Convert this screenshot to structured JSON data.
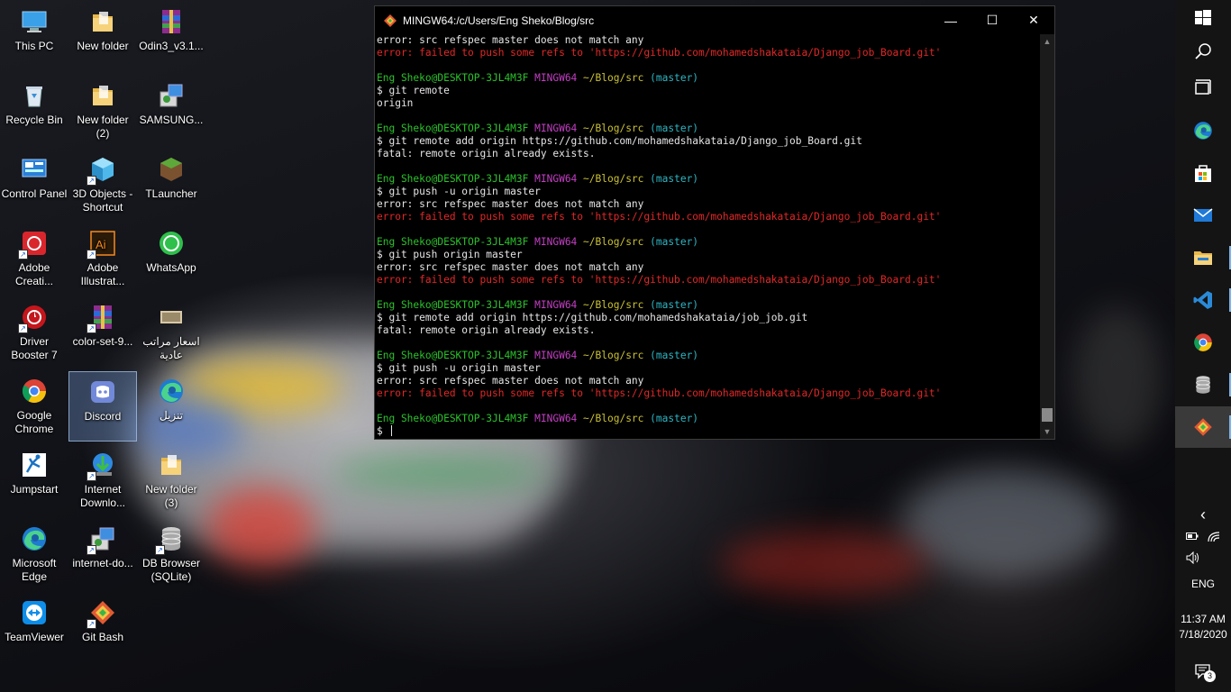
{
  "desktop": {
    "icons": [
      {
        "label": "This PC",
        "icon": "this-pc-icon"
      },
      {
        "label": "New folder",
        "icon": "folder-icon"
      },
      {
        "label": "Odin3_v3.1...",
        "icon": "winrar-icon"
      },
      {
        "label": "Recycle Bin",
        "icon": "recycle-bin-icon"
      },
      {
        "label": "New folder (2)",
        "icon": "folder-icon"
      },
      {
        "label": "SAMSUNG...",
        "icon": "installer-icon"
      },
      {
        "label": "Control Panel",
        "icon": "control-panel-icon"
      },
      {
        "label": "3D Objects - Shortcut",
        "icon": "3d-objects-icon"
      },
      {
        "label": "TLauncher",
        "icon": "minecraft-block-icon"
      },
      {
        "label": "Adobe Creati...",
        "icon": "adobe-cc-icon"
      },
      {
        "label": "Adobe Illustrat...",
        "icon": "illustrator-icon"
      },
      {
        "label": "WhatsApp",
        "icon": "whatsapp-icon"
      },
      {
        "label": "Driver Booster 7",
        "icon": "driver-booster-icon"
      },
      {
        "label": "color-set-9...",
        "icon": "winrar-icon"
      },
      {
        "label": "اسعار مراتب عادية",
        "icon": "image-file-icon"
      },
      {
        "label": "Google Chrome",
        "icon": "chrome-icon"
      },
      {
        "label": "Discord",
        "icon": "discord-icon"
      },
      {
        "label": "تنزيل",
        "icon": "edge-icon"
      },
      {
        "label": "Jumpstart",
        "icon": "jumpstart-icon"
      },
      {
        "label": "Internet Downlo...",
        "icon": "idm-icon"
      },
      {
        "label": "New folder (3)",
        "icon": "folder-icon"
      },
      {
        "label": "Microsoft Edge",
        "icon": "edge-icon"
      },
      {
        "label": "internet-do...",
        "icon": "installer-icon"
      },
      {
        "label": "DB Browser (SQLite)",
        "icon": "database-icon"
      },
      {
        "label": "TeamViewer",
        "icon": "teamviewer-icon"
      },
      {
        "label": "Git Bash",
        "icon": "git-icon"
      }
    ]
  },
  "terminal": {
    "title": "MINGW64:/c/Users/Eng Sheko/Blog/src",
    "buttons": {
      "minimize": "—",
      "maximize": "☐",
      "close": "✕"
    },
    "prompt": {
      "user": "Eng Sheko@DESKTOP-3JL4M3F",
      "env": "MINGW64",
      "path": "~/Blog/src",
      "branch": "(master)"
    },
    "lines": [
      {
        "type": "plain",
        "text": "error: src refspec master does not match any"
      },
      {
        "type": "error",
        "text": "error: failed to push some refs to 'https://github.com/mohamedshakataia/Django_job_Board.git'"
      },
      {
        "type": "blank",
        "text": ""
      },
      {
        "type": "prompt",
        "text": ""
      },
      {
        "type": "plain",
        "text": "$ git remote"
      },
      {
        "type": "plain",
        "text": "origin"
      },
      {
        "type": "blank",
        "text": ""
      },
      {
        "type": "prompt",
        "text": ""
      },
      {
        "type": "plain",
        "text": "$ git remote add origin https://github.com/mohamedshakataia/Django_job_Board.git"
      },
      {
        "type": "plain",
        "text": "fatal: remote origin already exists."
      },
      {
        "type": "blank",
        "text": ""
      },
      {
        "type": "prompt",
        "text": ""
      },
      {
        "type": "plain",
        "text": "$ git push -u origin master"
      },
      {
        "type": "plain",
        "text": "error: src refspec master does not match any"
      },
      {
        "type": "error",
        "text": "error: failed to push some refs to 'https://github.com/mohamedshakataia/Django_job_Board.git'"
      },
      {
        "type": "blank",
        "text": ""
      },
      {
        "type": "prompt",
        "text": ""
      },
      {
        "type": "plain",
        "text": "$ git push origin master"
      },
      {
        "type": "plain",
        "text": "error: src refspec master does not match any"
      },
      {
        "type": "error",
        "text": "error: failed to push some refs to 'https://github.com/mohamedshakataia/Django_job_Board.git'"
      },
      {
        "type": "blank",
        "text": ""
      },
      {
        "type": "prompt",
        "text": ""
      },
      {
        "type": "plain",
        "text": "$ git remote add origin https://github.com/mohamedshakataia/job_job.git"
      },
      {
        "type": "plain",
        "text": "fatal: remote origin already exists."
      },
      {
        "type": "blank",
        "text": ""
      },
      {
        "type": "prompt",
        "text": ""
      },
      {
        "type": "plain",
        "text": "$ git push -u origin master"
      },
      {
        "type": "plain",
        "text": "error: src refspec master does not match any"
      },
      {
        "type": "error",
        "text": "error: failed to push some refs to 'https://github.com/mohamedshakataia/Django_job_Board.git'"
      },
      {
        "type": "blank",
        "text": ""
      },
      {
        "type": "prompt",
        "text": ""
      },
      {
        "type": "input",
        "text": "$ "
      }
    ]
  },
  "taskbar": {
    "buttons": [
      {
        "name": "start-button",
        "icon": "windows-logo-icon"
      },
      {
        "name": "search-button",
        "icon": "search-icon"
      },
      {
        "name": "task-view-button",
        "icon": "task-view-icon"
      },
      {
        "name": "taskbar-edge",
        "icon": "edge-icon"
      },
      {
        "name": "taskbar-store",
        "icon": "store-icon"
      },
      {
        "name": "taskbar-mail",
        "icon": "mail-icon"
      },
      {
        "name": "taskbar-file-explorer",
        "icon": "folder-icon"
      },
      {
        "name": "taskbar-vscode",
        "icon": "vscode-icon"
      },
      {
        "name": "taskbar-chrome",
        "icon": "chrome-icon"
      },
      {
        "name": "taskbar-db-browser",
        "icon": "database-icon"
      },
      {
        "name": "taskbar-git-bash",
        "icon": "git-icon"
      }
    ],
    "tray": {
      "language": "ENG",
      "time": "11:37 AM",
      "date": "7/18/2020",
      "notifications": "3"
    }
  }
}
